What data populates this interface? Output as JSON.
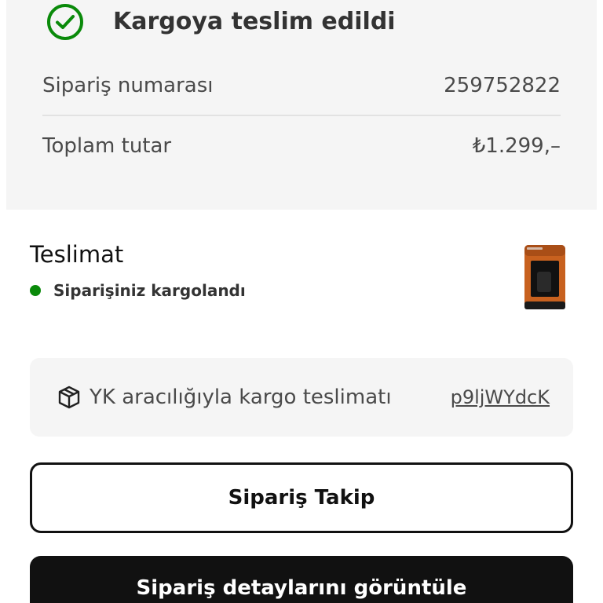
{
  "summary": {
    "status_title": "Kargoya teslim edildi",
    "status_icon": "check-circle-icon",
    "status_color": "#0a8a0a",
    "order_number_label": "Sipariş numarası",
    "order_number_value": "259752822",
    "total_label": "Toplam tutar",
    "total_value": "₺1.299,–"
  },
  "delivery": {
    "title": "Teslimat",
    "status_text": "Siparişiniz kargolandı",
    "status_dot_color": "#0a8a0a",
    "product_image": "turkish-coffee-machine-orange"
  },
  "courier": {
    "icon": "package-icon",
    "text": "YK aracılığıyla kargo teslimatı",
    "tracking_code": "p9ljWYdcK"
  },
  "buttons": {
    "track_label": "Sipariş Takip",
    "details_label": "Sipariş detaylarını görüntüle"
  }
}
